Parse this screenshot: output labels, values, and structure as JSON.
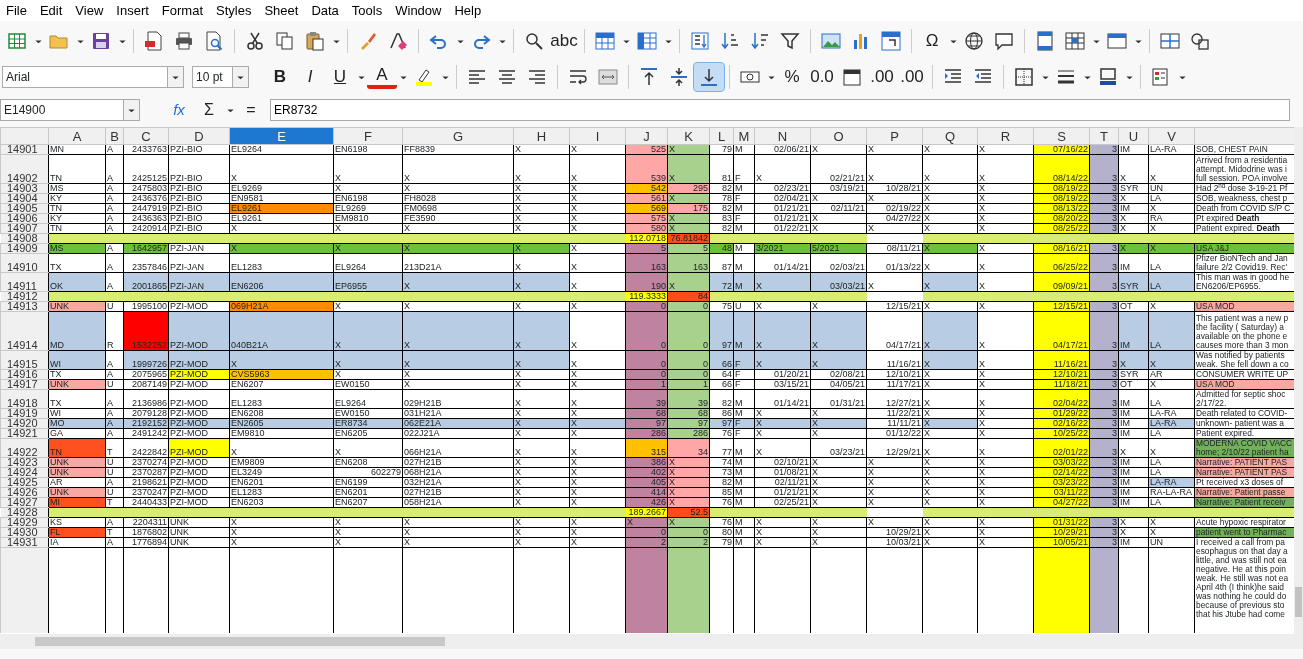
{
  "menu": [
    "File",
    "Edit",
    "View",
    "Insert",
    "Format",
    "Styles",
    "Sheet",
    "Data",
    "Tools",
    "Window",
    "Help"
  ],
  "toolbar_1": [
    {
      "kind": "icon"
    },
    {
      "kind": "dropdown"
    },
    {
      "kind": "icon"
    },
    {
      "kind": "dropdown"
    },
    {
      "kind": "icon"
    },
    {
      "kind": "dropdown"
    },
    {
      "kind": "separator"
    },
    {
      "kind": "icon"
    },
    {
      "kind": "icon"
    },
    {
      "kind": "icon"
    },
    {
      "kind": "separator"
    },
    {
      "kind": "icon"
    },
    {
      "kind": "icon"
    },
    {
      "kind": "icon"
    },
    {
      "kind": "dropdown"
    },
    {
      "kind": "separator"
    },
    {
      "kind": "icon"
    },
    {
      "kind": "icon"
    },
    {
      "kind": "separator"
    },
    {
      "kind": "icon"
    },
    {
      "kind": "dropdown"
    },
    {
      "kind": "icon"
    },
    {
      "kind": "dropdown"
    },
    {
      "kind": "separator"
    },
    {
      "kind": "icon"
    },
    {
      "kind": "glyph",
      "label": "abc"
    },
    {
      "kind": "separator"
    },
    {
      "kind": "icon"
    },
    {
      "kind": "dropdown"
    },
    {
      "kind": "icon"
    },
    {
      "kind": "dropdown"
    },
    {
      "kind": "separator"
    },
    {
      "kind": "icon"
    },
    {
      "kind": "icon"
    },
    {
      "kind": "icon"
    },
    {
      "kind": "icon"
    },
    {
      "kind": "separator"
    },
    {
      "kind": "icon"
    },
    {
      "kind": "icon"
    },
    {
      "kind": "icon"
    },
    {
      "kind": "separator"
    },
    {
      "kind": "glyph",
      "label": "Ω"
    },
    {
      "kind": "dropdown"
    },
    {
      "kind": "icon"
    },
    {
      "kind": "icon"
    },
    {
      "kind": "separator"
    },
    {
      "kind": "icon"
    },
    {
      "kind": "icon"
    },
    {
      "kind": "dropdown"
    },
    {
      "kind": "icon"
    },
    {
      "kind": "dropdown"
    },
    {
      "kind": "separator"
    },
    {
      "kind": "icon"
    },
    {
      "kind": "icon"
    }
  ],
  "font_name": "Arial",
  "font_size": "10 pt",
  "toolbar_2": [
    {
      "kind": "glyph",
      "label": "B",
      "pressed": false
    },
    {
      "kind": "glyph",
      "label": "I",
      "pressed": false
    },
    {
      "kind": "glyph",
      "label": "U",
      "pressed": false
    },
    {
      "kind": "dropdown"
    },
    {
      "kind": "glyph",
      "label": "A",
      "pressed": false
    },
    {
      "kind": "dropdown"
    },
    {
      "kind": "icon",
      "pressed": false
    },
    {
      "kind": "dropdown"
    },
    {
      "kind": "separator"
    },
    {
      "kind": "icon",
      "pressed": false
    },
    {
      "kind": "icon",
      "pressed": false
    },
    {
      "kind": "icon",
      "pressed": false
    },
    {
      "kind": "separator"
    },
    {
      "kind": "icon",
      "pressed": false
    },
    {
      "kind": "icon",
      "pressed": false
    },
    {
      "kind": "separator"
    },
    {
      "kind": "icon",
      "pressed": false
    },
    {
      "kind": "icon",
      "pressed": false
    },
    {
      "kind": "icon",
      "pressed": true
    },
    {
      "kind": "separator"
    },
    {
      "kind": "icon",
      "pressed": false
    },
    {
      "kind": "dropdown"
    },
    {
      "kind": "glyph",
      "label": "%",
      "pressed": false
    },
    {
      "kind": "glyph",
      "label": "0.0",
      "pressed": false
    },
    {
      "kind": "icon",
      "pressed": false
    },
    {
      "kind": "glyph",
      "label": ".00",
      "pressed": false
    },
    {
      "kind": "glyph",
      "label": ".00",
      "pressed": false
    },
    {
      "kind": "separator"
    },
    {
      "kind": "icon",
      "pressed": false
    },
    {
      "kind": "icon",
      "pressed": false
    },
    {
      "kind": "separator"
    },
    {
      "kind": "icon",
      "pressed": false
    },
    {
      "kind": "dropdown"
    },
    {
      "kind": "icon",
      "pressed": false
    },
    {
      "kind": "dropdown"
    },
    {
      "kind": "icon",
      "pressed": false
    },
    {
      "kind": "dropdown"
    },
    {
      "kind": "separator"
    },
    {
      "kind": "icon",
      "pressed": false
    },
    {
      "kind": "dropdown"
    }
  ],
  "formula_bar": {
    "name_box": "E14900",
    "function_wizard": "fx",
    "sum": "Σ",
    "equals": "=",
    "content": "ER8732"
  },
  "columns": [
    {
      "label": "A",
      "selected": false
    },
    {
      "label": "B",
      "selected": false
    },
    {
      "label": "C",
      "selected": false
    },
    {
      "label": "D",
      "selected": false
    },
    {
      "label": "E",
      "selected": true
    },
    {
      "label": "F",
      "selected": false
    },
    {
      "label": "G",
      "selected": false
    },
    {
      "label": "H",
      "selected": false
    },
    {
      "label": "I",
      "selected": false
    },
    {
      "label": "J",
      "selected": false,
      "color": "#c0839f"
    },
    {
      "label": "K",
      "selected": false,
      "color": "#a9d18e"
    },
    {
      "label": "L",
      "selected": false
    },
    {
      "label": "M",
      "selected": false
    },
    {
      "label": "N",
      "selected": false
    },
    {
      "label": "O",
      "selected": false
    },
    {
      "label": "P",
      "selected": false
    },
    {
      "label": "Q",
      "selected": false
    },
    {
      "label": "R",
      "selected": false
    },
    {
      "label": "S",
      "selected": false,
      "color": "#ffff00"
    },
    {
      "label": "T",
      "selected": false,
      "color": "#b4b1cc"
    },
    {
      "label": "U",
      "selected": false
    },
    {
      "label": "V",
      "selected": false
    }
  ],
  "rows": [
    {
      "number": "14901",
      "kind": "record",
      "cells": [
        "MN",
        "A",
        "2433763",
        "PZI-BIO",
        "EL9264",
        "EN6198",
        "FF8839",
        "X",
        "X",
        {
          "value": "525",
          "color": "#ffa7a7"
        },
        "X",
        "79",
        "M",
        "02/06/21",
        "X",
        "X",
        "X",
        "X",
        "07/16/22",
        "3",
        "IM",
        "LA-RA"
      ],
      "note": {
        "lines": [
          "SOB, CHEST PAIN"
        ]
      }
    },
    {
      "number": "14902",
      "kind": "record",
      "cells": [
        "TN",
        "A",
        "2425125",
        "PZI-BIO",
        "X",
        "X",
        "X",
        "X",
        "X",
        {
          "value": "539",
          "color": "#ffa7a7"
        },
        "X",
        "81",
        "F",
        "X",
        "02/21/21",
        "X",
        "X",
        "X",
        "08/14/22",
        "3",
        "X",
        "X"
      ],
      "note": {
        "lines": [
          "Arrived from a residentia",
          "attempt. Midodrine was i",
          "full session. POA involve"
        ]
      }
    },
    {
      "number": "14903",
      "kind": "record",
      "cells": [
        "MS",
        "A",
        "2475803",
        "PZI-BIO",
        "EL9269",
        "X",
        "X",
        "X",
        "X",
        {
          "value": "542",
          "color": "#ffc000"
        },
        {
          "value": "295",
          "color": "#ffa7a7"
        },
        "82",
        "M",
        "02/23/21",
        "03/19/21",
        "10/28/21",
        "X",
        "X",
        "08/19/22",
        "3",
        "SYR",
        "UN"
      ],
      "note": {
        "lines": [
          "Had 2$^{nd}$ dose 3-19-21 Pf"
        ]
      }
    },
    {
      "number": "14904",
      "kind": "record",
      "cells": [
        "KY",
        "A",
        "2436376",
        "PZI-BIO",
        "EN9581",
        "EN6198",
        "FH8028",
        "X",
        "X",
        {
          "value": "561",
          "color": "#ffa7a7"
        },
        "X",
        "78",
        "F",
        "02/04/21",
        "X",
        "X",
        "X",
        "X",
        "08/19/22",
        "3",
        "X",
        "LA"
      ],
      "note": {
        "lines": [
          "SOB, weakness, chest p"
        ]
      }
    },
    {
      "number": "14905",
      "kind": "record",
      "cells": [
        "TN",
        "A",
        "2447919",
        "PZI-BIO",
        {
          "value": "EL9261",
          "color": "#ff8c00"
        },
        "EL9269",
        "FM0698",
        "X",
        "X",
        {
          "value": "569",
          "color": "#ffc000"
        },
        {
          "value": "175",
          "color": "#ffa7a7"
        },
        "82",
        "M",
        "01/21/21",
        "02/11/21",
        "02/19/22",
        "X",
        "X",
        "08/13/22",
        "3",
        "IM",
        "X"
      ],
      "note": {
        "lines": [
          "Death from COVID S/P C"
        ]
      }
    },
    {
      "number": "14906",
      "kind": "record",
      "cells": [
        "KY",
        "A",
        "2436363",
        "PZI-BIO",
        "EL9261",
        "EM9810",
        "FE3590",
        "X",
        "X",
        {
          "value": "575",
          "color": "#ffa7a7"
        },
        "X",
        "83",
        "F",
        "01/21/21",
        "X",
        "04/27/22",
        "X",
        "X",
        "08/20/22",
        "3",
        "X",
        "RA"
      ],
      "note": {
        "lines": [
          "Pt expired **Death**"
        ]
      }
    },
    {
      "number": "14907",
      "kind": "record",
      "cells": [
        "TN",
        "A",
        "2420914",
        "PZI-BIO",
        "X",
        "X",
        "X",
        "X",
        "X",
        {
          "value": "580",
          "color": "#ffa7a7"
        },
        "X",
        "82",
        "M",
        "01/22/21",
        "X",
        "X",
        "X",
        "X",
        "08/25/22",
        "3",
        "X",
        "X"
      ],
      "note": {
        "lines": [
          "Patient expired. **Death**"
        ]
      }
    },
    {
      "number": "14908",
      "kind": "subtotal",
      "cells": [
        {
          "color": "#d9ec74"
        },
        {
          "color": "#d9ec74"
        },
        {
          "color": "#d9ec74"
        },
        {
          "color": "#d9ec74"
        },
        {
          "color": "#d9ec74"
        },
        {
          "color": "#d9ec74"
        },
        {
          "color": "#d9ec74"
        },
        {
          "color": "#d9ec74"
        },
        {
          "color": "#d9ec74"
        },
        {
          "value": "112.0718",
          "color": "#ffff00"
        },
        {
          "value": "76.81842",
          "color": "#ff4a1a"
        },
        {
          "color": "#d9ec74"
        },
        {
          "color": "#d9ec74"
        },
        {
          "color": "#d9ec74"
        },
        {
          "color": "#d9ec74"
        },
        null,
        {
          "color": "#d9ec74"
        },
        {
          "color": "#d9ec74"
        },
        {
          "color": "#d9ec74"
        },
        {
          "color": "#d9ec74"
        },
        {
          "color": "#d9ec74"
        },
        {
          "color": "#d9ec74"
        }
      ],
      "note": {
        "color": "#d9ec74"
      }
    },
    {
      "number": "14909",
      "kind": "record",
      "cells": [
        {
          "value": "MS",
          "color": "#6cc13a"
        },
        "A",
        {
          "value": "1642957",
          "color": "#6cc13a"
        },
        "PZI-JAN",
        {
          "value": "X",
          "color": "#6cc13a"
        },
        {
          "value": "X",
          "color": "#6cc13a"
        },
        {
          "value": "X",
          "color": "#6cc13a"
        },
        {
          "value": "X",
          "color": "#6cc13a"
        },
        "X",
        "5",
        "5",
        {
          "value": "48",
          "color": "#6cc13a"
        },
        "M",
        {
          "value": "3/2021",
          "color": "#6cc13a",
          "as_text": true
        },
        {
          "value": "5/2021",
          "color": "#6cc13a",
          "as_text": true
        },
        "08/11/21",
        {
          "value": "X",
          "color": "#6cc13a"
        },
        "X",
        "08/16/21",
        "3",
        {
          "value": "X",
          "color": "#6cc13a"
        },
        {
          "value": "X",
          "color": "#6cc13a"
        }
      ],
      "note": {
        "lines": [
          "USA J&J"
        ],
        "color": "#6cc13a"
      }
    },
    {
      "number": "14910",
      "kind": "record",
      "cells": [
        "TX",
        "A",
        "2357846",
        "PZI-JAN",
        "EL1283",
        "EL9264",
        "213D21A",
        "X",
        "X",
        "163",
        "163",
        "87",
        "M",
        "01/14/21",
        "02/03/21",
        "01/13/22",
        "X",
        "X",
        "06/25/22",
        "3",
        "IM",
        "LA"
      ],
      "note": {
        "lines": [
          "Pfizer BioNTech and Jan",
          "failure 2/2 Covid19. Rec'"
        ]
      }
    },
    {
      "number": "14911",
      "kind": "record",
      "cells": [
        {
          "value": "OK",
          "color": "#b8cce4"
        },
        "A",
        {
          "value": "2001865",
          "color": "#b8cce4"
        },
        {
          "value": "PZI-JAN",
          "color": "#b8cce4"
        },
        {
          "value": "EN6206",
          "color": "#b8cce4"
        },
        {
          "value": "EP6955",
          "color": "#b8cce4"
        },
        {
          "value": "X",
          "color": "#b8cce4"
        },
        {
          "value": "X",
          "color": "#b8cce4"
        },
        "X",
        "190",
        "X",
        {
          "value": "72",
          "color": "#b8cce4"
        },
        {
          "value": "M",
          "color": "#b8cce4"
        },
        {
          "value": "X",
          "color": "#b8cce4"
        },
        {
          "value": "03/03/21",
          "color": "#b8cce4"
        },
        "X",
        {
          "value": "X",
          "color": "#b8cce4"
        },
        "X",
        "09/09/21",
        "3",
        {
          "value": "SYR",
          "color": "#b8cce4"
        },
        {
          "value": "LA",
          "color": "#b8cce4"
        }
      ],
      "note": {
        "lines": [
          "This man was in good he",
          "EN6206/EP6955."
        ]
      }
    },
    {
      "number": "14912",
      "kind": "subtotal",
      "cells": [
        {
          "color": "#d9ec74"
        },
        {
          "color": "#d9ec74"
        },
        {
          "color": "#d9ec74"
        },
        {
          "color": "#d9ec74"
        },
        {
          "color": "#d9ec74"
        },
        {
          "color": "#d9ec74"
        },
        {
          "color": "#d9ec74"
        },
        {
          "color": "#d9ec74"
        },
        {
          "color": "#d9ec74"
        },
        {
          "value": "119.3333",
          "color": "#ffff00"
        },
        {
          "value": "84",
          "color": "#ff4a1a"
        },
        {
          "color": "#d9ec74"
        },
        {
          "color": "#d9ec74"
        },
        {
          "color": "#d9ec74"
        },
        {
          "color": "#d9ec74"
        },
        null,
        {
          "color": "#d9ec74"
        },
        {
          "color": "#d9ec74"
        },
        {
          "color": "#d9ec74"
        },
        {
          "color": "#d9ec74"
        },
        {
          "color": "#d9ec74"
        },
        {
          "color": "#d9ec74"
        }
      ],
      "note": {
        "color": "#d9ec74"
      }
    },
    {
      "number": "14913",
      "kind": "record",
      "cells": [
        {
          "value": "UNK",
          "color": "#f7a8a0"
        },
        "U",
        "1995100",
        "PZI-MOD",
        {
          "value": "069H21A",
          "color": "#ff8c00"
        },
        "X",
        "X",
        "X",
        "X",
        "0",
        "0",
        "75",
        "U",
        "X",
        "X",
        "12/15/21",
        "X",
        "X",
        "12/15/21",
        "3",
        "OT",
        "X"
      ],
      "note": {
        "lines": [
          "USA MOD"
        ],
        "color": "#f7a8a0"
      }
    },
    {
      "number": "14914",
      "kind": "record",
      "cells": [
        {
          "value": "MD",
          "color": "#b8cce4"
        },
        "R",
        {
          "value": "1532252",
          "color": "#ff0000"
        },
        {
          "value": "PZI-MOD",
          "color": "#b8cce4"
        },
        {
          "value": "040B21A",
          "color": "#b8cce4"
        },
        {
          "value": "X",
          "color": "#b8cce4"
        },
        {
          "value": "X",
          "color": "#b8cce4"
        },
        {
          "value": "X",
          "color": "#b8cce4"
        },
        "X",
        "0",
        "0",
        {
          "value": "97",
          "color": "#b8cce4"
        },
        {
          "value": "M",
          "color": "#b8cce4"
        },
        {
          "value": "X",
          "color": "#b8cce4"
        },
        {
          "value": "X",
          "color": "#b8cce4"
        },
        "04/17/21",
        {
          "value": "X",
          "color": "#b8cce4"
        },
        "X",
        "04/17/21",
        "3",
        {
          "value": "IM",
          "color": "#b8cce4"
        },
        {
          "value": "LA",
          "color": "#b8cce4"
        }
      ],
      "note": {
        "lines": [
          "This patient was a new p",
          "the facility ( Saturday) a",
          "available on the phone e",
          "causes more than 3 mon"
        ]
      }
    },
    {
      "number": "14915",
      "kind": "record",
      "cells": [
        {
          "value": "WI",
          "color": "#b8cce4"
        },
        "A",
        {
          "value": "1999726",
          "color": "#b8cce4"
        },
        {
          "value": "PZI-MOD",
          "color": "#b8cce4"
        },
        {
          "value": "X",
          "color": "#b8cce4"
        },
        {
          "value": "X",
          "color": "#b8cce4"
        },
        {
          "value": "X",
          "color": "#b8cce4"
        },
        {
          "value": "X",
          "color": "#b8cce4"
        },
        "X",
        "0",
        "0",
        {
          "value": "66",
          "color": "#b8cce4"
        },
        {
          "value": "F",
          "color": "#b8cce4"
        },
        {
          "value": "X",
          "color": "#b8cce4"
        },
        {
          "value": "X",
          "color": "#b8cce4"
        },
        "11/16/21",
        {
          "value": "X",
          "color": "#b8cce4"
        },
        "X",
        "11/16/21",
        "3",
        {
          "value": "X",
          "color": "#b8cce4"
        },
        {
          "value": "X",
          "color": "#b8cce4"
        }
      ],
      "note": {
        "lines": [
          "Was notified by patients",
          "weak. She fell down a co"
        ]
      }
    },
    {
      "number": "14916",
      "kind": "record",
      "cells": [
        "TX",
        "A",
        "2075965",
        {
          "value": "PZI-MOD",
          "color": "#ffff00"
        },
        {
          "value": "CVS5963",
          "color": "#ffc000"
        },
        "X",
        "X",
        "X",
        "X",
        "0",
        "0",
        "64",
        "F",
        "01/20/21",
        "02/08/21",
        "12/10/21",
        "X",
        "X",
        "12/10/21",
        "3",
        "SYR",
        "AR"
      ],
      "note": {
        "lines": [
          "CONSUMER WRITE UP"
        ]
      }
    },
    {
      "number": "14917",
      "kind": "record",
      "cells": [
        {
          "value": "UNK",
          "color": "#f7a8a0"
        },
        "U",
        "2087149",
        "PZI-MOD",
        "EN6207",
        "EW0150",
        "X",
        "X",
        "X",
        "1",
        "1",
        "66",
        "F",
        "03/15/21",
        "04/05/21",
        "11/17/21",
        "X",
        "X",
        "11/18/21",
        "3",
        "OT",
        "X"
      ],
      "note": {
        "lines": [
          "USA MOD"
        ],
        "color": "#f7a8a0"
      }
    },
    {
      "number": "14918",
      "kind": "record",
      "cells": [
        "TX",
        "A",
        "2136986",
        "PZI-MOD",
        "EL1283",
        "EL9264",
        "029H21B",
        "X",
        "X",
        "39",
        "39",
        "82",
        "M",
        "01/14/21",
        "01/31/21",
        "12/27/21",
        "X",
        "X",
        "02/04/22",
        "3",
        "IM",
        "LA"
      ],
      "note": {
        "lines": [
          "Admitted for septic shoc",
          "2/17/22."
        ]
      }
    },
    {
      "number": "14919",
      "kind": "record",
      "cells": [
        "WI",
        "A",
        "2079128",
        "PZI-MOD",
        "EN6208",
        "EW0150",
        "031H21A",
        "X",
        "X",
        "68",
        "68",
        "86",
        "M",
        "X",
        "X",
        "11/22/21",
        "X",
        "X",
        "01/29/22",
        "3",
        "IM",
        "LA-RA"
      ],
      "note": {
        "lines": [
          "Death related to COVID-"
        ]
      }
    },
    {
      "number": "14920",
      "kind": "record",
      "cells": [
        {
          "value": "MO",
          "color": "#b8cce4"
        },
        {
          "value": "A",
          "color": "#b8cce4"
        },
        {
          "value": "2192152",
          "color": "#b8cce4"
        },
        {
          "value": "PZI-MOD",
          "color": "#b8cce4"
        },
        {
          "value": "EN2605",
          "color": "#b8cce4"
        },
        {
          "value": "ER8734",
          "color": "#b8cce4"
        },
        {
          "value": "062E21A",
          "color": "#b8cce4"
        },
        {
          "value": "X",
          "color": "#b8cce4"
        },
        {
          "value": "X",
          "color": "#b8cce4"
        },
        "97",
        "97",
        {
          "value": "97",
          "color": "#b8cce4"
        },
        {
          "value": "F",
          "color": "#b8cce4"
        },
        {
          "value": "X",
          "color": "#b8cce4"
        },
        {
          "value": "X",
          "color": "#b8cce4"
        },
        "11/11/21",
        {
          "value": "X",
          "color": "#b8cce4"
        },
        "X",
        "02/16/22",
        "3",
        "IM",
        {
          "value": "LA-RA",
          "color": "#b8cce4"
        }
      ],
      "note": {
        "lines": [
          "unknown- patient was a"
        ]
      }
    },
    {
      "number": "14921",
      "kind": "record",
      "cells": [
        "GA",
        "A",
        "2491242",
        "PZI-MOD",
        "EM9810",
        "EN6205",
        "022J21A",
        "X",
        "X",
        "286",
        "286",
        "76",
        "F",
        "X",
        "X",
        "01/12/22",
        "X",
        "X",
        "10/25/22",
        "3",
        "IM",
        "LA"
      ],
      "note": {
        "lines": [
          "Patient expired."
        ]
      }
    },
    {
      "number": "14922",
      "kind": "record",
      "cells": [
        {
          "value": "TN",
          "color": "#ff5020"
        },
        "T",
        "2422842",
        {
          "value": "PZI-MOD",
          "color": "#ffff00"
        },
        "X",
        "X",
        "066H21A",
        "X",
        "X",
        {
          "value": "315",
          "color": "#ffc000"
        },
        {
          "value": "34",
          "color": "#ffa7a7"
        },
        "77",
        "M",
        "X",
        "03/23/21",
        "12/29/21",
        "X",
        "X",
        "02/01/22",
        "3",
        "X",
        "X"
      ],
      "note": {
        "lines": [
          "MODERNA COVID VACC",
          "home; 2/10/22 patient ha"
        ],
        "color": "#72b05a"
      }
    },
    {
      "number": "14923",
      "kind": "record",
      "cells": [
        {
          "value": "UNK",
          "color": "#f7a8a0"
        },
        "U",
        "2370274",
        "PZI-MOD",
        "EM9809",
        "EN6208",
        "027H21B",
        "X",
        "X",
        "386",
        {
          "value": "X",
          "color": "#ffa7a7"
        },
        "74",
        "M",
        "02/10/21",
        "X",
        "X",
        "X",
        "X",
        "03/03/22",
        "3",
        "IM",
        "LA"
      ],
      "note": {
        "lines": [
          "Narrative: PATIENT PAS"
        ],
        "color": "#f7a8a0"
      }
    },
    {
      "number": "14924",
      "kind": "record",
      "cells": [
        {
          "value": "UNK",
          "color": "#f7a8a0"
        },
        "U",
        "2370287",
        "PZI-MOD",
        "EL3249",
        "602279",
        "068H21A",
        "X",
        "X",
        "402",
        {
          "value": "X",
          "color": "#ffa7a7"
        },
        "73",
        "M",
        "01/08/21",
        "X",
        "X",
        "X",
        "X",
        "02/14/22",
        "3",
        "IM",
        "LA"
      ],
      "note": {
        "lines": [
          "Narrative: PATIENT PAS"
        ],
        "color": "#f7a8a0"
      }
    },
    {
      "number": "14925",
      "kind": "record",
      "cells": [
        "AR",
        "A",
        "2198621",
        "PZI-MOD",
        "EN6201",
        "EN6199",
        "032H21A",
        "X",
        "X",
        "405",
        {
          "value": "X",
          "color": "#ffa7a7"
        },
        "82",
        "M",
        "02/11/21",
        "X",
        "X",
        "X",
        "X",
        "03/23/22",
        "3",
        "IM",
        {
          "value": "LA-RA",
          "color": "#b8cce4"
        }
      ],
      "note": {
        "lines": [
          "Pt received x3 doses of"
        ]
      }
    },
    {
      "number": "14926",
      "kind": "record",
      "cells": [
        {
          "value": "UNK",
          "color": "#f7a8a0"
        },
        "U",
        "2370247",
        "PZI-MOD",
        "EL1283",
        "EN6201",
        "027H21B",
        "X",
        "X",
        "414",
        {
          "value": "X",
          "color": "#ffa7a7"
        },
        "85",
        "M",
        "01/21/21",
        "X",
        "X",
        "X",
        "X",
        "03/11/22",
        "3",
        "IM",
        "RA-LA-RA"
      ],
      "note": {
        "lines": [
          "Narrative: Patient passe"
        ],
        "color": "#f7a8a0"
      }
    },
    {
      "number": "14927",
      "kind": "record",
      "cells": [
        {
          "value": "MI",
          "color": "#ff5020"
        },
        "T",
        "2440433",
        "PZI-MOD",
        "EN6203",
        "EN6207",
        "058H21A",
        "X",
        "X",
        "426",
        {
          "value": "X",
          "color": "#ffa7a7"
        },
        "76",
        "M",
        "02/25/21",
        "X",
        "X",
        "X",
        "X",
        "04/27/22",
        "3",
        "IM",
        "LA"
      ],
      "note": {
        "lines": [
          "Narrative: Patient receiv"
        ],
        "color": "#72b05a"
      }
    },
    {
      "number": "14928",
      "kind": "subtotal",
      "cells": [
        {
          "color": "#d9ec74"
        },
        {
          "color": "#d9ec74"
        },
        {
          "color": "#d9ec74"
        },
        {
          "color": "#d9ec74"
        },
        {
          "color": "#d9ec74"
        },
        {
          "color": "#d9ec74"
        },
        {
          "color": "#d9ec74"
        },
        {
          "color": "#d9ec74"
        },
        {
          "color": "#d9ec74"
        },
        {
          "value": "189.2667",
          "color": "#ffff00"
        },
        {
          "value": "52.5",
          "color": "#ff4a1a"
        },
        {
          "color": "#d9ec74"
        },
        {
          "color": "#d9ec74"
        },
        {
          "color": "#d9ec74"
        },
        {
          "color": "#d9ec74"
        },
        null,
        {
          "color": "#d9ec74"
        },
        {
          "color": "#d9ec74"
        },
        {
          "color": "#d9ec74"
        },
        {
          "color": "#d9ec74"
        },
        {
          "color": "#d9ec74"
        },
        {
          "color": "#d9ec74"
        }
      ],
      "note": {
        "color": "#d9ec74"
      }
    },
    {
      "number": "14929",
      "kind": "record",
      "cells": [
        "KS",
        "A",
        "2204311",
        "UNK",
        "X",
        "X",
        "X",
        "X",
        "X",
        "X",
        "X",
        "76",
        "M",
        "X",
        "X",
        "X",
        "X",
        "X",
        "01/31/22",
        "3",
        "X",
        "X"
      ],
      "note": {
        "lines": [
          "Acute hypoxic respirator"
        ]
      }
    },
    {
      "number": "14930",
      "kind": "record",
      "cells": [
        {
          "value": "FL",
          "color": "#ff5020"
        },
        "T",
        "1876802",
        "UNK",
        "X",
        "X",
        "X",
        "X",
        "X",
        "0",
        "0",
        "80",
        "M",
        "X",
        "X",
        "10/29/21",
        "X",
        "X",
        "10/29/21",
        "3",
        "X",
        "X"
      ],
      "note": {
        "lines": [
          "patient went to Pharmac"
        ],
        "color": "#72b05a"
      }
    },
    {
      "number": "14931",
      "kind": "record",
      "cells": [
        "IA",
        "A",
        "1776894",
        "UNK",
        "X",
        "X",
        "X",
        "X",
        "X",
        "2",
        "2",
        "79",
        "M",
        "X",
        "X",
        "10/03/21",
        "X",
        "X",
        "10/05/21",
        "3",
        "IM",
        "UN"
      ],
      "note": {
        "lines": [
          "I received a call from pa"
        ]
      },
      "note_overflow": [
        "esophagus on that day a",
        "little, and was still not ea",
        "negative. He at this poin",
        "weak. He still was not ea",
        "April 4th (I think)he said",
        "was nothing he could do",
        "because of previous sto",
        "that his  Jtube had come"
      ]
    }
  ]
}
